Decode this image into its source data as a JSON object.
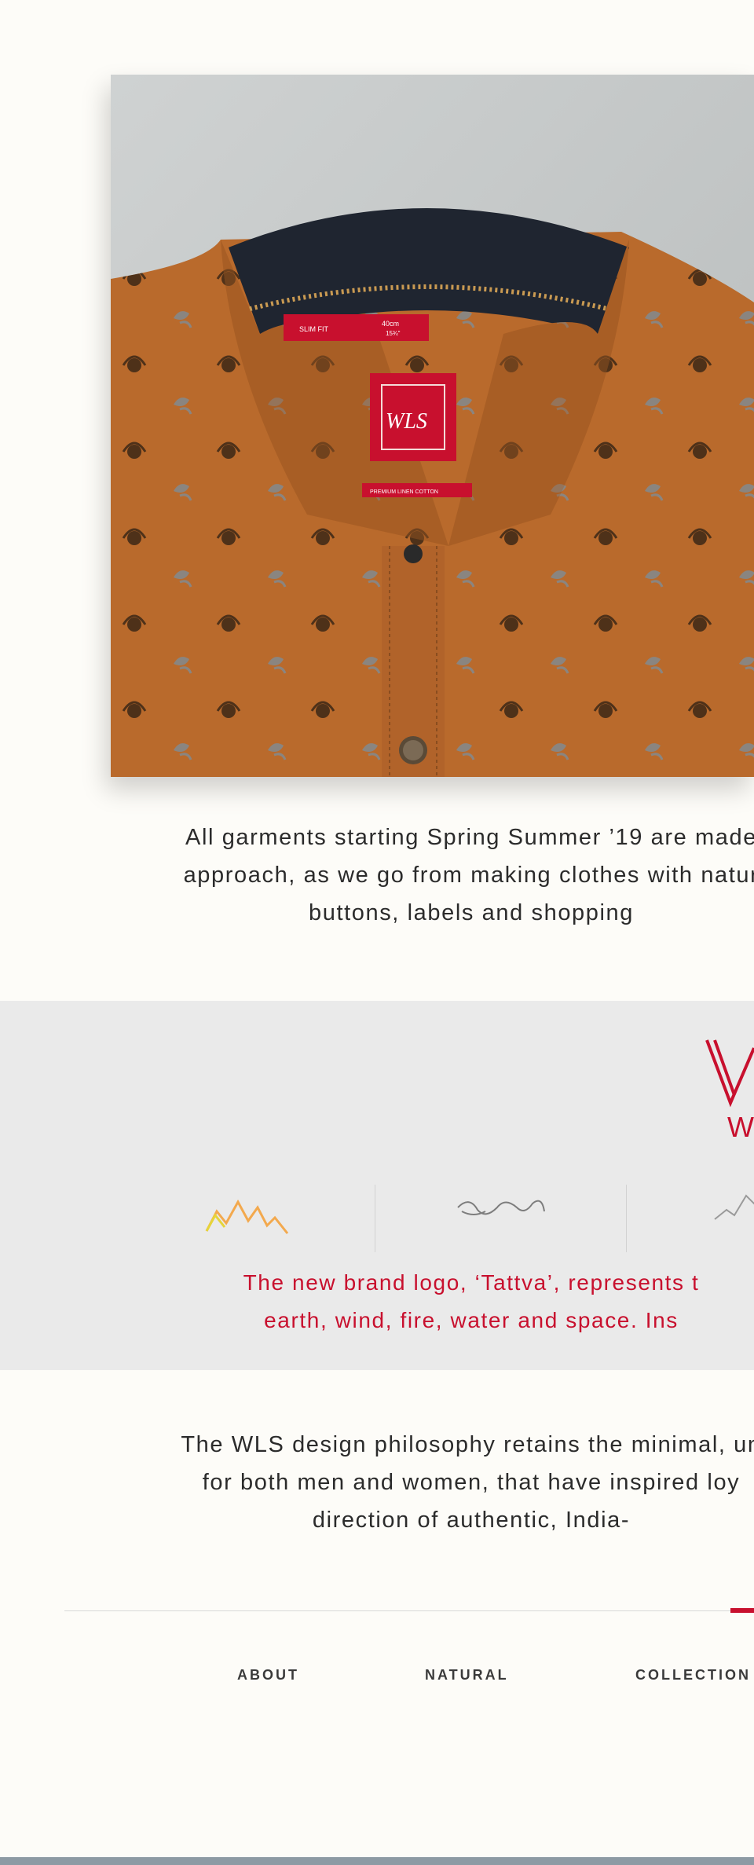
{
  "hero": {
    "alt": "Orange floral linen shirt collar with WLS label",
    "label_top_left": "SLIM FIT",
    "label_top_right": "40cm",
    "label_top_right_sub": "15¾\"",
    "label_brand": "WLS",
    "label_bottom": "PREMIUM LINEN COTTON"
  },
  "intro": {
    "lines": [
      "All garments starting Spring Summer ’19 are made",
      "approach, as we go from making clothes with natur",
      "buttons, labels and shopping"
    ]
  },
  "logo_band": {
    "brand_word": "W",
    "icons": [
      "earth-icon",
      "wind-icon",
      "fire-icon"
    ],
    "tattva_lines": [
      "The new brand logo, ‘Tattva’, represents t",
      "earth, wind, fire, water and space. Ins"
    ],
    "accent": "#c8102e"
  },
  "philosophy": {
    "lines": [
      "The WLS design philosophy retains the minimal, un",
      "for both men and women, that have inspired loy",
      "direction of authentic, India-"
    ]
  },
  "nav": {
    "items": [
      "ABOUT",
      "NATURAL",
      "COLLECTION"
    ]
  },
  "colors": {
    "background": "#fdfcf8",
    "band": "#eaeaea",
    "accent": "#c8102e",
    "footer_bar": "#8d9aa4"
  }
}
